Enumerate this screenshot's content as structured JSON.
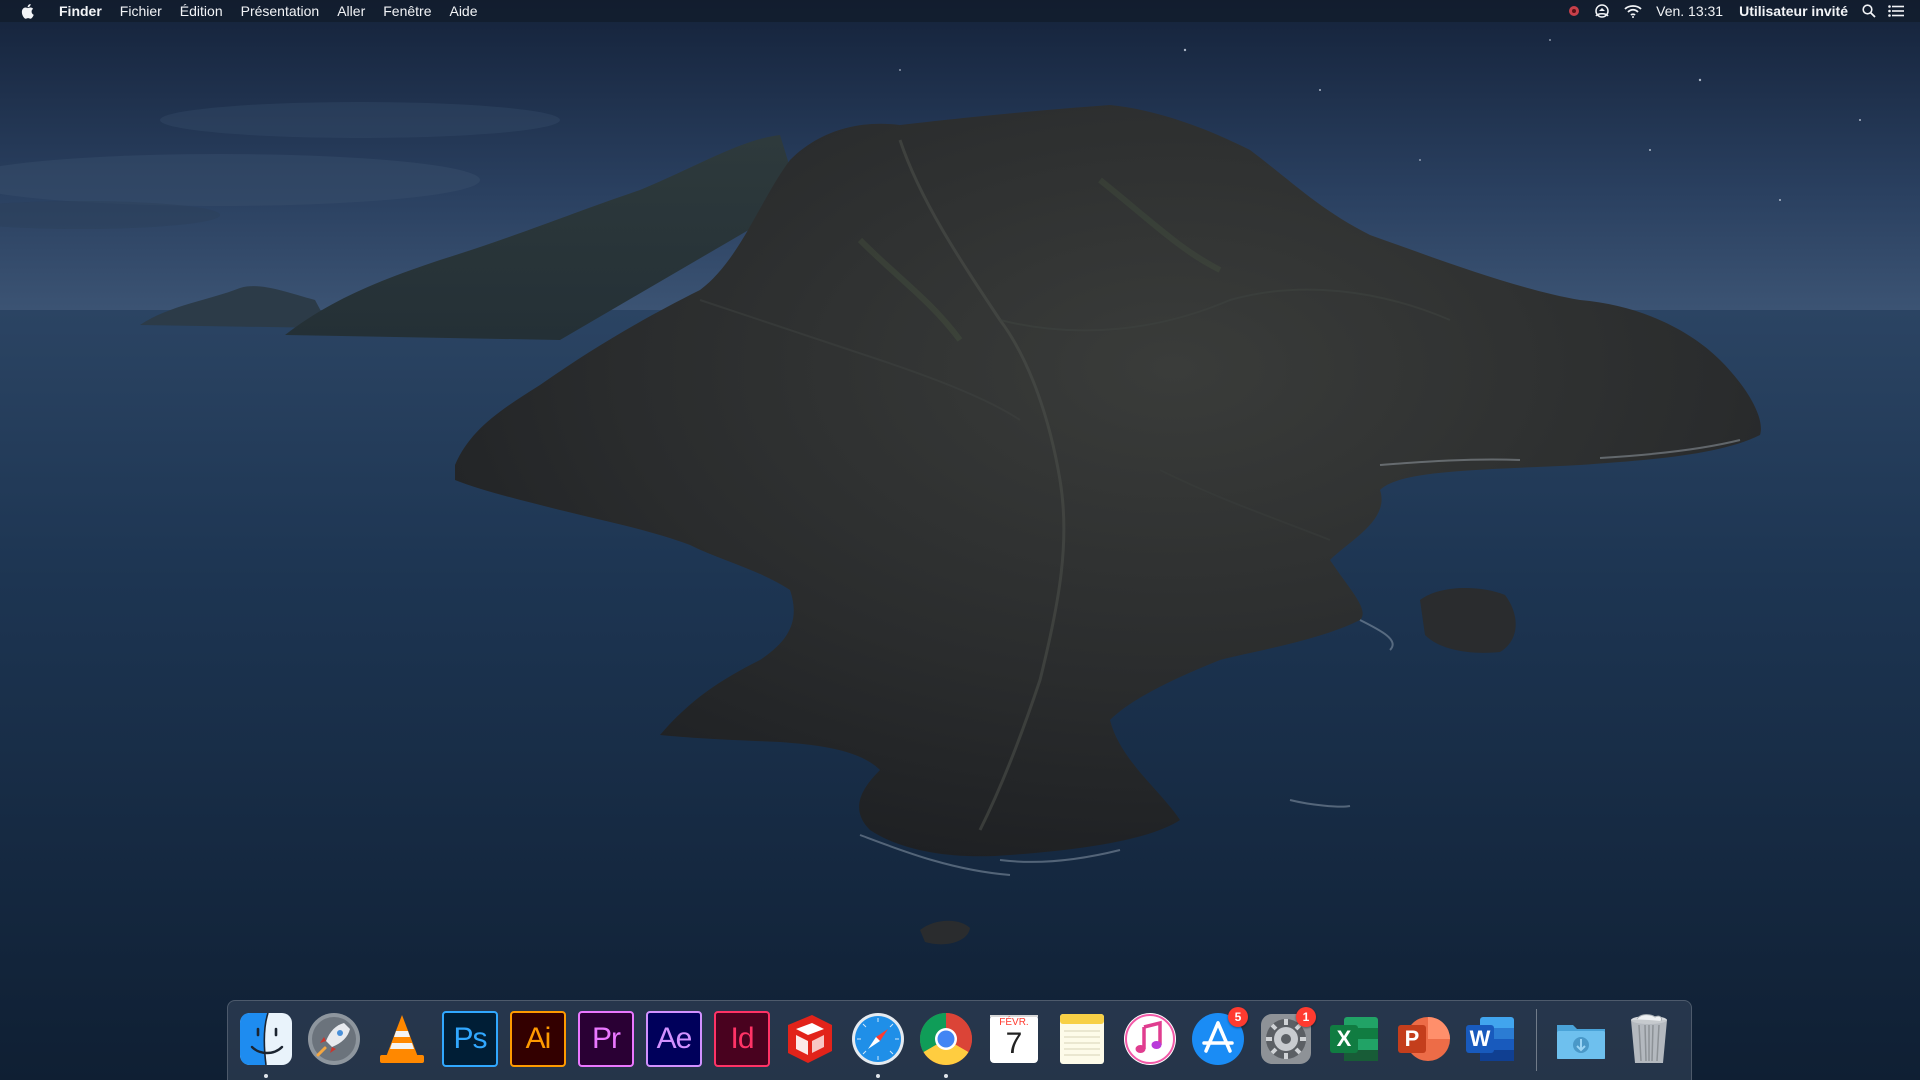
{
  "menubar": {
    "apple_icon": "apple-logo-icon",
    "app_name": "Finder",
    "menus": [
      "Fichier",
      "Édition",
      "Présentation",
      "Aller",
      "Fenêtre",
      "Aide"
    ],
    "status_icons": [
      "record-indicator-icon",
      "airplay-screen-icon",
      "wifi-icon"
    ],
    "clock": "Ven. 13:31",
    "user": "Utilisateur invité",
    "search_icon": "spotlight-search-icon",
    "notification_icon": "notification-center-icon"
  },
  "dock": {
    "apps": [
      {
        "name": "Finder",
        "icon": "finder-icon",
        "running": true
      },
      {
        "name": "Launchpad",
        "icon": "launchpad-rocket-icon",
        "running": false
      },
      {
        "name": "VLC",
        "icon": "vlc-cone-icon",
        "running": false
      },
      {
        "name": "Photoshop",
        "icon": "photoshop-icon",
        "running": false,
        "label": "Ps",
        "bg": "#001e36",
        "fg": "#31a8ff"
      },
      {
        "name": "Illustrator",
        "icon": "illustrator-icon",
        "running": false,
        "label": "Ai",
        "bg": "#330000",
        "fg": "#ff9a00"
      },
      {
        "name": "Premiere Pro",
        "icon": "premiere-icon",
        "running": false,
        "label": "Pr",
        "bg": "#2a0034",
        "fg": "#ea77ff"
      },
      {
        "name": "After Effects",
        "icon": "after-effects-icon",
        "running": false,
        "label": "Ae",
        "bg": "#00005b",
        "fg": "#d291ff"
      },
      {
        "name": "InDesign",
        "icon": "indesign-icon",
        "running": false,
        "label": "Id",
        "bg": "#49021f",
        "fg": "#ff3366"
      },
      {
        "name": "SketchUp",
        "icon": "sketchup-icon",
        "running": false
      },
      {
        "name": "Safari",
        "icon": "safari-compass-icon",
        "running": true
      },
      {
        "name": "Chrome",
        "icon": "chrome-icon",
        "running": true
      },
      {
        "name": "Calendrier",
        "icon": "calendar-icon",
        "running": false,
        "month": "FÉVR.",
        "day": "7"
      },
      {
        "name": "Notes",
        "icon": "notes-icon",
        "running": false
      },
      {
        "name": "iTunes",
        "icon": "itunes-icon",
        "running": false
      },
      {
        "name": "App Store",
        "icon": "app-store-icon",
        "running": false,
        "badge": "5"
      },
      {
        "name": "Préférences Système",
        "icon": "system-preferences-gear-icon",
        "running": false,
        "badge": "1"
      },
      {
        "name": "Excel",
        "icon": "excel-icon",
        "running": false,
        "label": "X"
      },
      {
        "name": "PowerPoint",
        "icon": "powerpoint-icon",
        "running": false,
        "label": "P"
      },
      {
        "name": "Word",
        "icon": "word-icon",
        "running": false,
        "label": "W"
      }
    ],
    "stacks": [
      {
        "name": "Téléchargements",
        "icon": "downloads-folder-icon"
      },
      {
        "name": "Corbeille",
        "icon": "trash-icon"
      }
    ]
  },
  "colors": {
    "sky_top": "#13223a",
    "sea": "#1b3350",
    "island": "#26282a",
    "badge": "#ff3b30"
  }
}
